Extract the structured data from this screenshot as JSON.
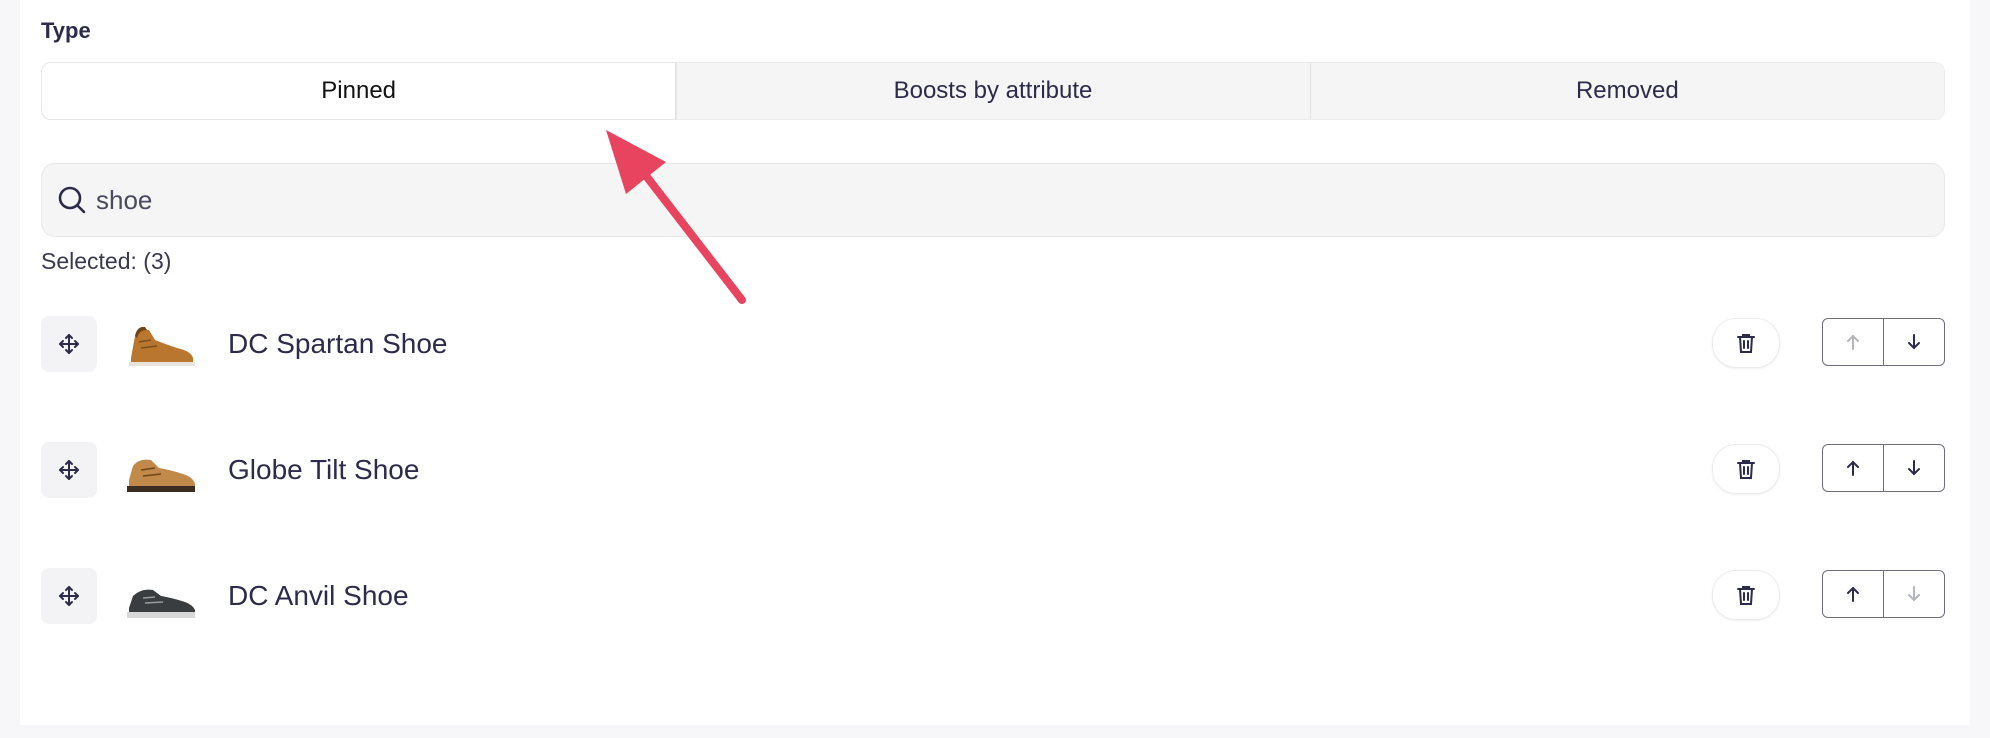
{
  "type_section": {
    "label": "Type",
    "tabs": [
      {
        "label": "Pinned",
        "active": true
      },
      {
        "label": "Boosts by attribute",
        "active": false
      },
      {
        "label": "Removed",
        "active": false
      }
    ]
  },
  "search": {
    "value": "shoe",
    "icon": "search-icon"
  },
  "selected_label": "Selected: (3)",
  "items": [
    {
      "name": "DC Spartan Shoe",
      "up_disabled": true,
      "down_disabled": false,
      "shoe_color": "#b8762e"
    },
    {
      "name": "Globe Tilt Shoe",
      "up_disabled": false,
      "down_disabled": false,
      "shoe_color": "#c28a4a"
    },
    {
      "name": "DC Anvil Shoe",
      "up_disabled": false,
      "down_disabled": true,
      "shoe_color": "#3a3d3f"
    }
  ],
  "colors": {
    "annotation_arrow": "#e8435f",
    "text": "#2c2b4a"
  }
}
